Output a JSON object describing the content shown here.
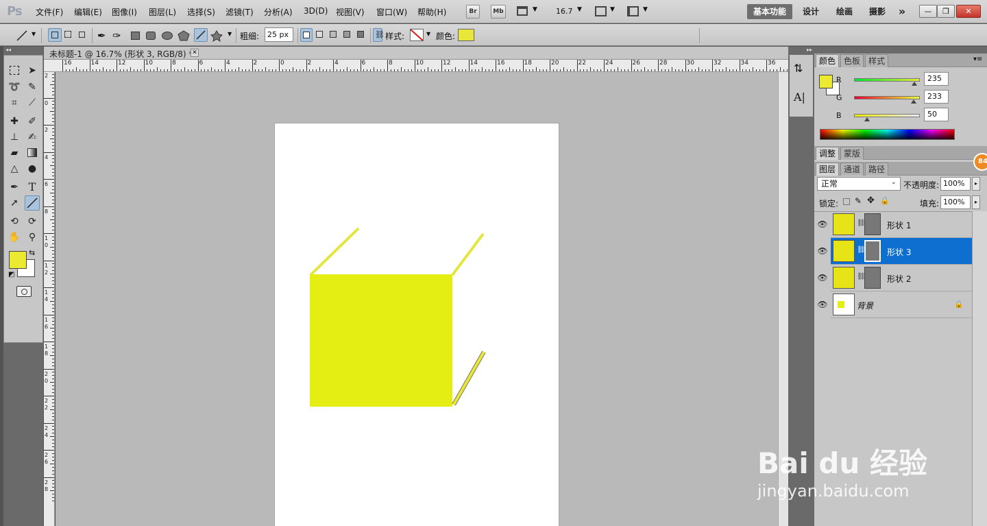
{
  "app": {
    "logo": "Ps"
  },
  "menu": [
    "文件(F)",
    "编辑(E)",
    "图像(I)",
    "图层(L)",
    "选择(S)",
    "滤镜(T)",
    "分析(A)",
    "3D(D)",
    "视图(V)",
    "窗口(W)",
    "帮助(H)"
  ],
  "menubar_buttons": {
    "bridge": "Br",
    "minibridge": "Mb",
    "zoom": "16.7"
  },
  "workspaces": [
    "基本功能",
    "设计",
    "绘画",
    "摄影"
  ],
  "workspace_more": "»",
  "window_controls": {
    "minimize": "—",
    "restore": "❐",
    "close": "✕"
  },
  "options": {
    "weight_label": "粗细:",
    "weight_value": "25 px",
    "style_label": "样式:",
    "color_label": "颜色:",
    "color_hex": "#e9e63a"
  },
  "document": {
    "tab_title": "未标题-1 @ 16.7% (形状 3, RGB/8) *",
    "close": "✕"
  },
  "rulers": {
    "top_labels": [
      "16",
      "14",
      "12",
      "10",
      "8",
      "6",
      "4",
      "2",
      "0",
      "2",
      "4",
      "6",
      "8",
      "10",
      "12",
      "14",
      "16",
      "18",
      "20",
      "22",
      "24",
      "26",
      "28",
      "30",
      "32",
      "34",
      "36"
    ],
    "left_labels": [
      "2",
      "0",
      "2",
      "4",
      "6",
      "8",
      "1 0",
      "1 2",
      "1 4",
      "1 6",
      "1 8",
      "2 0",
      "2 2",
      "2 4",
      "2 6",
      "2 8"
    ]
  },
  "colors": {
    "foreground": "#ebe932",
    "background": "#ffffff",
    "shape_fill": "#e4ee12",
    "selection": "#0f6fd1"
  },
  "color_panel": {
    "tabs": [
      "颜色",
      "色板",
      "样式"
    ],
    "channels": [
      {
        "label": "R",
        "value": "235",
        "fraction": 0.92
      },
      {
        "label": "G",
        "value": "233",
        "fraction": 0.91
      },
      {
        "label": "B",
        "value": "50",
        "fraction": 0.2
      }
    ]
  },
  "adjust_panel": {
    "tabs": [
      "调整",
      "蒙版"
    ]
  },
  "layers_panel": {
    "tabs": [
      "图层",
      "通道",
      "路径"
    ],
    "blend_mode": "正常",
    "opacity_label": "不透明度:",
    "opacity_value": "100%",
    "lock_label": "锁定:",
    "fill_label": "填充:",
    "fill_value": "100%",
    "layers": [
      {
        "name": "形状 1",
        "selected": false
      },
      {
        "name": "形状 3",
        "selected": true
      },
      {
        "name": "形状 2",
        "selected": false
      },
      {
        "name": "背景",
        "selected": false,
        "locked": true
      }
    ]
  },
  "badge": "84",
  "watermark": {
    "logo": "Bai du 经验",
    "url": "jingyan.baidu.com"
  }
}
